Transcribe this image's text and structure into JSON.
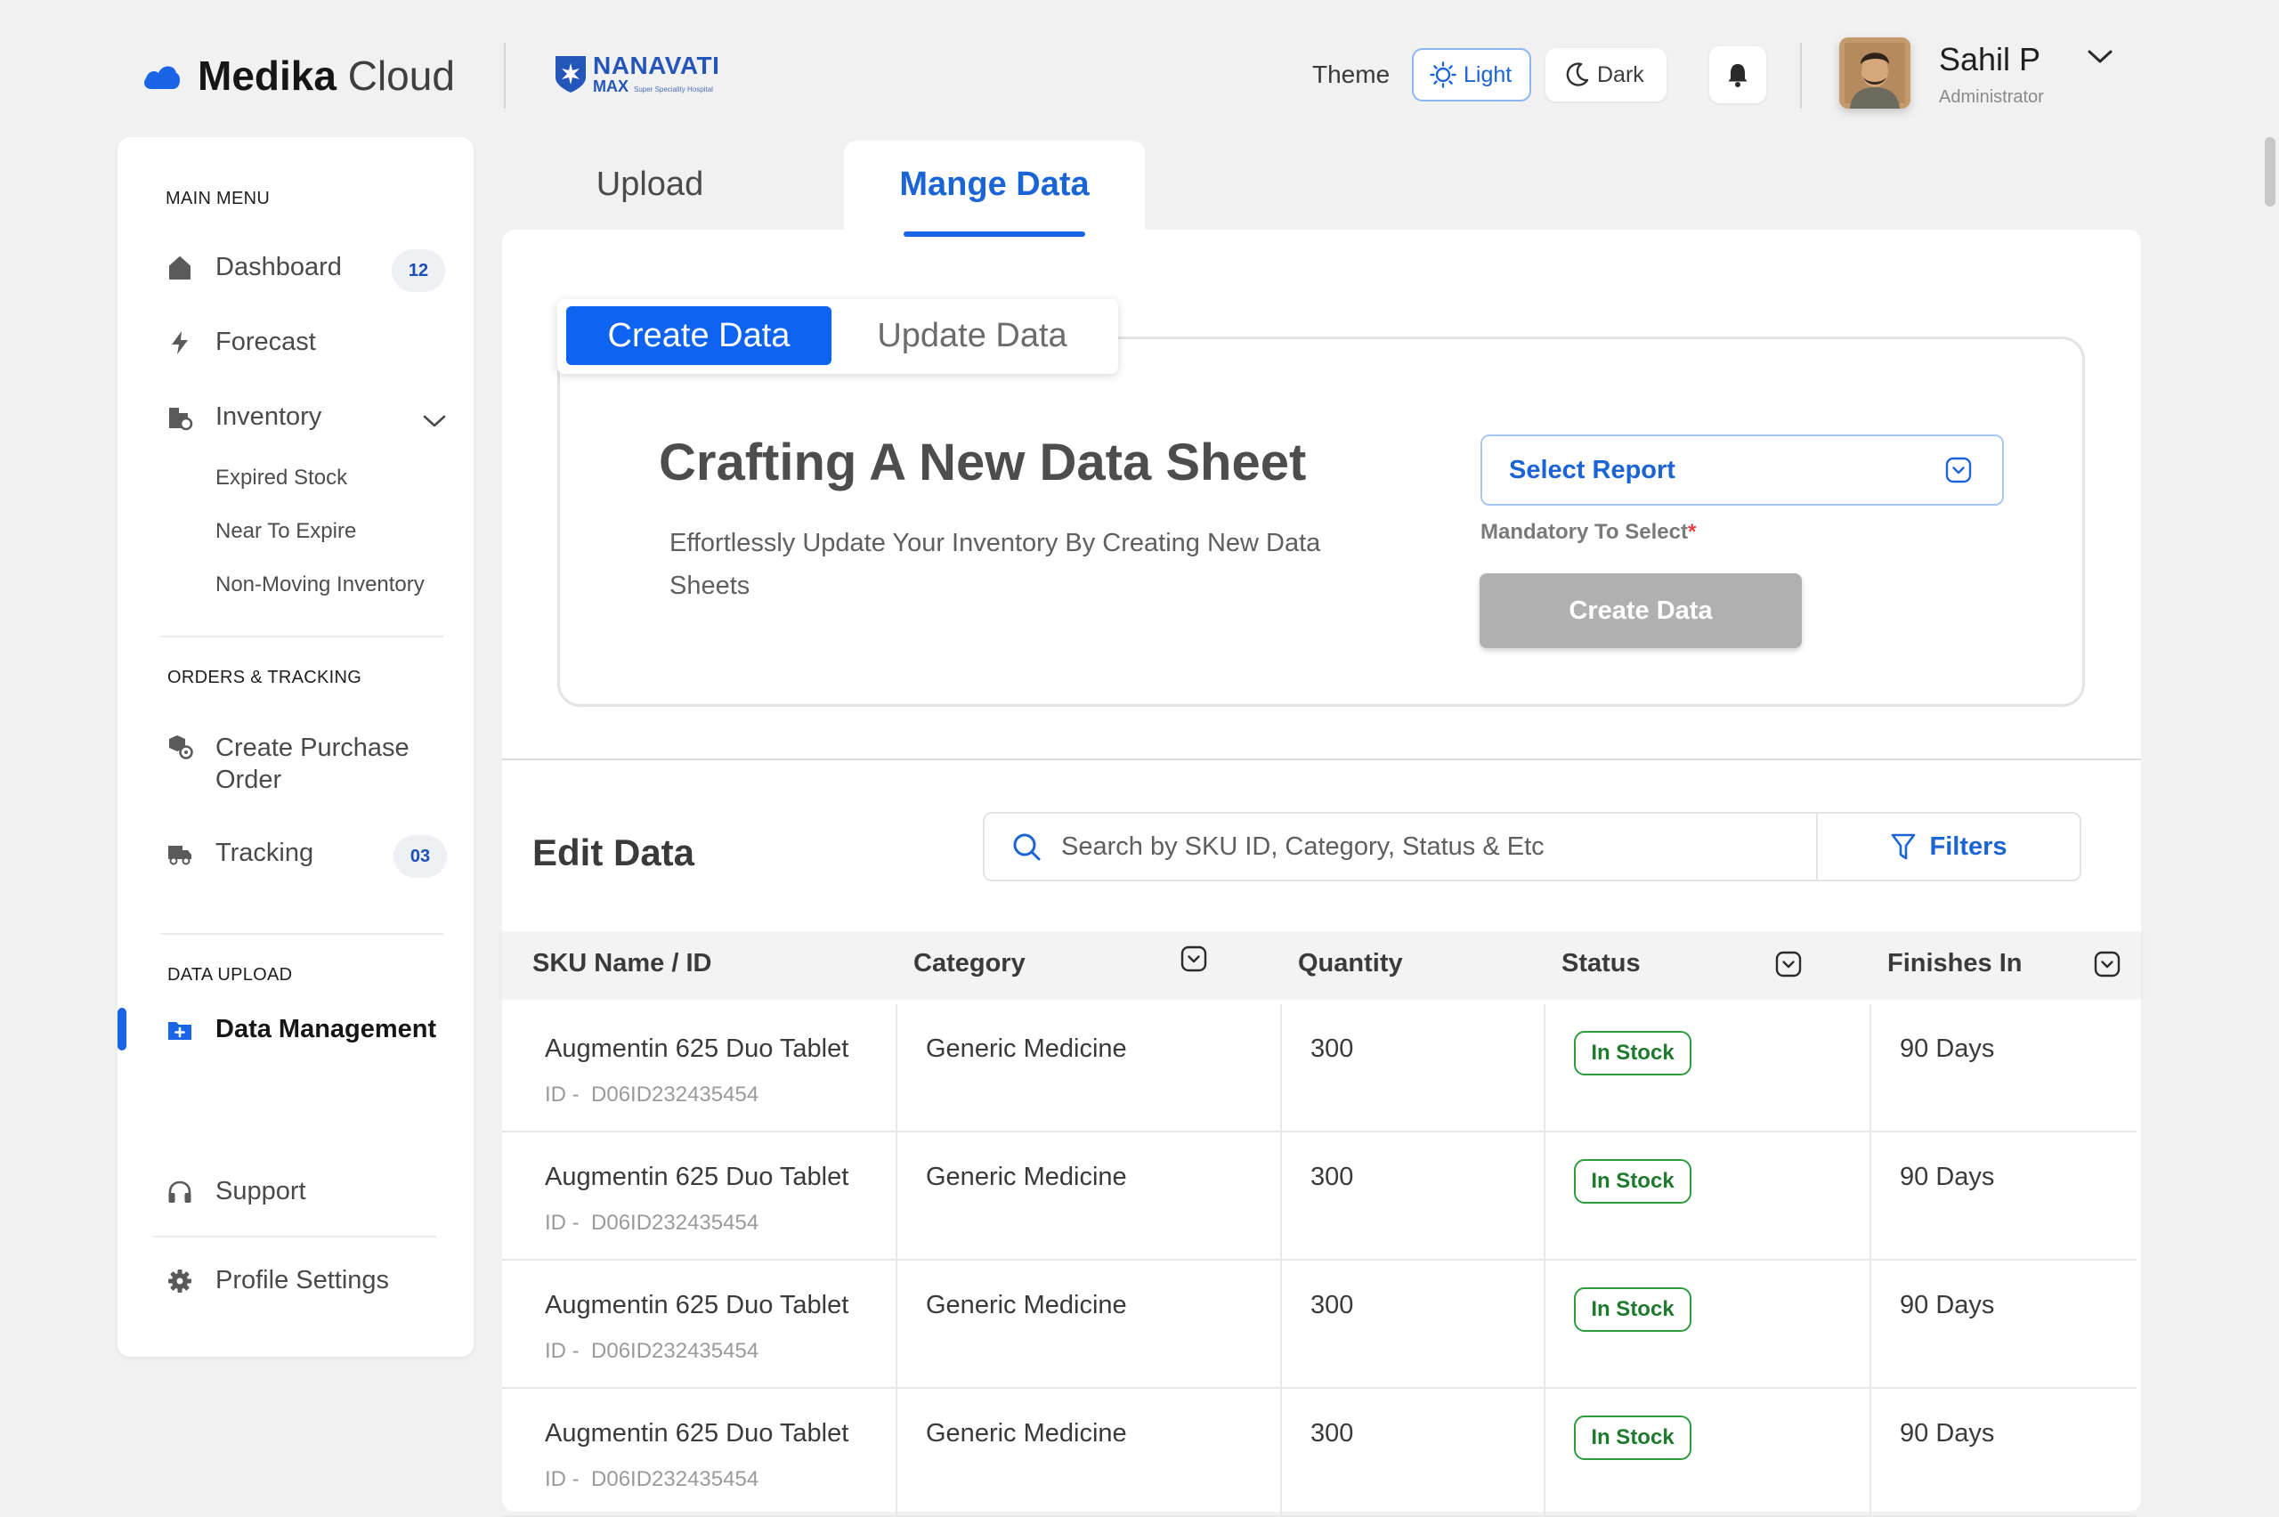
{
  "header": {
    "brand_bold": "Medika",
    "brand_light": "Cloud",
    "partner_main": "NANAVATI",
    "partner_sub": "MAX",
    "partner_tag": "Super Speciality Hospital",
    "theme_label": "Theme",
    "theme_light": "Light",
    "theme_dark": "Dark",
    "user_name": "Sahil P",
    "user_role": "Administrator"
  },
  "sidebar": {
    "main_menu_title": "MAIN MENU",
    "dashboard": "Dashboard",
    "dashboard_badge": "12",
    "forecast": "Forecast",
    "inventory": "Inventory",
    "inventory_sub": [
      "Expired Stock",
      "Near To Expire",
      "Non-Moving Inventory"
    ],
    "orders_title": "ORDERS & TRACKING",
    "create_po": "Create Purchase Order",
    "tracking": "Tracking",
    "tracking_badge": "03",
    "upload_title": "DATA UPLOAD",
    "data_management": "Data Management",
    "support": "Support",
    "profile_settings": "Profile Settings"
  },
  "tabs": {
    "upload": "Upload",
    "manage": "Mange Data"
  },
  "create": {
    "seg_create": "Create Data",
    "seg_update": "Update Data",
    "title": "Crafting A New Data Sheet",
    "description": "Effortlessly Update Your Inventory By Creating New Data Sheets",
    "select_placeholder": "Select Report",
    "mandatory_label": "Mandatory To Select",
    "mandatory_mark": "*",
    "create_button": "Create Data"
  },
  "edit": {
    "title": "Edit Data",
    "search_placeholder": "Search by SKU ID, Category, Status & Etc",
    "filters_label": "Filters",
    "columns": {
      "sku": "SKU Name / ID",
      "category": "Category",
      "quantity": "Quantity",
      "status": "Status",
      "finishes": "Finishes In"
    },
    "rows": [
      {
        "name": "Augmentin 625 Duo Tablet",
        "id_prefix": "ID -",
        "id": "D06ID232435454",
        "category": "Generic Medicine",
        "quantity": "300",
        "status": "In Stock",
        "finishes": "90 Days"
      },
      {
        "name": "Augmentin 625 Duo Tablet",
        "id_prefix": "ID -",
        "id": "D06ID232435454",
        "category": "Generic Medicine",
        "quantity": "300",
        "status": "In Stock",
        "finishes": "90 Days"
      },
      {
        "name": "Augmentin 625 Duo Tablet",
        "id_prefix": "ID -",
        "id": "D06ID232435454",
        "category": "Generic Medicine",
        "quantity": "300",
        "status": "In Stock",
        "finishes": "90 Days"
      },
      {
        "name": "Augmentin 625 Duo Tablet",
        "id_prefix": "ID -",
        "id": "D06ID232435454",
        "category": "Generic Medicine",
        "quantity": "300",
        "status": "In Stock",
        "finishes": "90 Days"
      }
    ]
  },
  "colors": {
    "accent": "#1a64e6",
    "status_green": "#2f9b3f",
    "disabled_button": "#b0b0b0"
  },
  "icons": [
    "cloud-icon",
    "hospital-logo-icon",
    "sun-icon",
    "moon-icon",
    "bell-icon",
    "chevron-down-icon",
    "home-icon",
    "lightning-icon",
    "inventory-icon",
    "purchase-order-icon",
    "truck-icon",
    "folder-plus-icon",
    "headphones-icon",
    "gear-icon",
    "search-icon",
    "filter-icon"
  ]
}
